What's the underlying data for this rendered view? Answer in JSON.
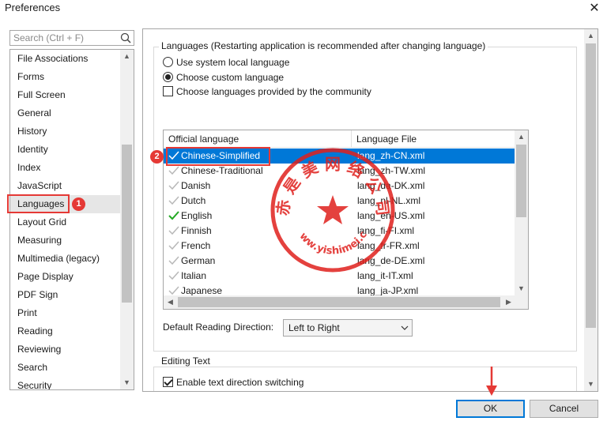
{
  "window": {
    "title": "Preferences",
    "close_glyph": "✕"
  },
  "search": {
    "placeholder": "Search (Ctrl + F)",
    "icon": "search-icon"
  },
  "nav": {
    "items": [
      "File Associations",
      "Forms",
      "Full Screen",
      "General",
      "History",
      "Identity",
      "Index",
      "JavaScript",
      "Languages",
      "Layout Grid",
      "Measuring",
      "Multimedia (legacy)",
      "Page Display",
      "PDF Sign",
      "Print",
      "Reading",
      "Reviewing",
      "Search",
      "Security"
    ],
    "selected": "Languages"
  },
  "languages": {
    "group_label": "Languages (Restarting application is recommended after changing language)",
    "opt_system": "Use system local language",
    "opt_custom": "Choose custom language",
    "opt_community": "Choose languages provided by the community",
    "selected_option": "custom",
    "community_checked": false,
    "columns": {
      "official": "Official language",
      "file": "Language File"
    },
    "rows": [
      {
        "name": "Chinese-Simplified",
        "file": "lang_zh-CN.xml",
        "selected": true,
        "active": false
      },
      {
        "name": "Chinese-Traditional",
        "file": "lang_zh-TW.xml",
        "selected": false,
        "active": false
      },
      {
        "name": "Danish",
        "file": "lang_da-DK.xml",
        "selected": false,
        "active": false
      },
      {
        "name": "Dutch",
        "file": "lang_nl-NL.xml",
        "selected": false,
        "active": false
      },
      {
        "name": "English",
        "file": "lang_en-US.xml",
        "selected": false,
        "active": true
      },
      {
        "name": "Finnish",
        "file": "lang_fi-FI.xml",
        "selected": false,
        "active": false
      },
      {
        "name": "French",
        "file": "lang_fr-FR.xml",
        "selected": false,
        "active": false
      },
      {
        "name": "German",
        "file": "lang_de-DE.xml",
        "selected": false,
        "active": false
      },
      {
        "name": "Italian",
        "file": "lang_it-IT.xml",
        "selected": false,
        "active": false
      },
      {
        "name": "Japanese",
        "file": "lang_ja-JP.xml",
        "selected": false,
        "active": false
      }
    ],
    "reading_direction_label": "Default Reading Direction:",
    "reading_direction_value": "Left to Right"
  },
  "editing": {
    "group_label": "Editing Text",
    "opt_direction": "Enable text direction switching",
    "direction_checked": true
  },
  "buttons": {
    "ok": "OK",
    "cancel": "Cancel"
  },
  "annotations": {
    "badge1": "1",
    "badge2": "2"
  },
  "watermark": {
    "text": "赤 是 美 网 络 公 司",
    "url": "www.yishimei.cn"
  },
  "colors": {
    "selection": "#0078d7",
    "annotation": "#e53935",
    "active_check": "#22a822",
    "inactive_check": "#b8b8b8"
  }
}
